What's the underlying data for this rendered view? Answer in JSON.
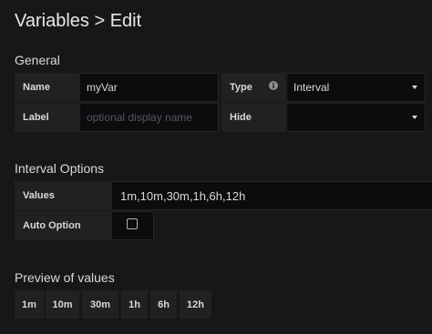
{
  "header": {
    "title": "Variables > Edit"
  },
  "general": {
    "section_title": "General",
    "name_label": "Name",
    "name_value": "myVar",
    "type_label": "Type",
    "type_info_icon": "info-circle-icon",
    "type_value": "Interval",
    "label_label": "Label",
    "label_placeholder": "optional display name",
    "hide_label": "Hide",
    "hide_value": ""
  },
  "interval_options": {
    "section_title": "Interval Options",
    "values_label": "Values",
    "values_value": "1m,10m,30m,1h,6h,12h",
    "auto_option_label": "Auto Option",
    "auto_option_checked": false
  },
  "preview": {
    "section_title": "Preview of values",
    "values": [
      "1m",
      "10m",
      "30m",
      "1h",
      "6h",
      "12h"
    ]
  },
  "colors": {
    "background": "#161719",
    "label_bg": "#212124",
    "input_bg": "#0b0c0e"
  }
}
